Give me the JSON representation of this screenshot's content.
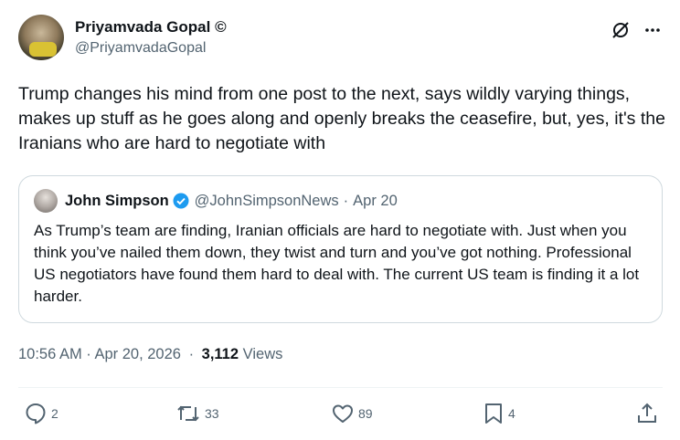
{
  "author": {
    "name": "Priyamvada Gopal ©",
    "handle": "@PriyamvadaGopal"
  },
  "tweet": {
    "text": "Trump changes his mind from one post to the next, says wildly varying things, makes up stuff as he goes along and openly breaks the ceasefire, but, yes, it's the Iranians who are hard to negotiate with"
  },
  "quote": {
    "name": "John Simpson",
    "handle": "@JohnSimpsonNews",
    "separator": "·",
    "date": "Apr 20",
    "text": "As Trump’s team are finding, Iranian officials are hard to negotiate with. Just when you think you’ve nailed them down, they twist and turn and you’ve got nothing. Professional US negotiators have found them hard to deal with. The current US team is finding it a lot harder."
  },
  "meta": {
    "timestamp": "10:56 AM · Apr 20, 2026",
    "separator": "·",
    "views_count": "3,112",
    "views_label": "Views"
  },
  "actions": {
    "replies": "2",
    "reposts": "33",
    "likes": "89",
    "bookmarks": "4"
  },
  "icons": {
    "top": [
      "grok-slash-icon",
      "more-icon"
    ],
    "actions": [
      "reply-icon",
      "repost-icon",
      "like-icon",
      "bookmark-icon",
      "share-icon"
    ]
  },
  "colors": {
    "text": "#0f1419",
    "secondary": "#536471",
    "border": "#cfd9de",
    "verified": "#1d9bf0"
  }
}
